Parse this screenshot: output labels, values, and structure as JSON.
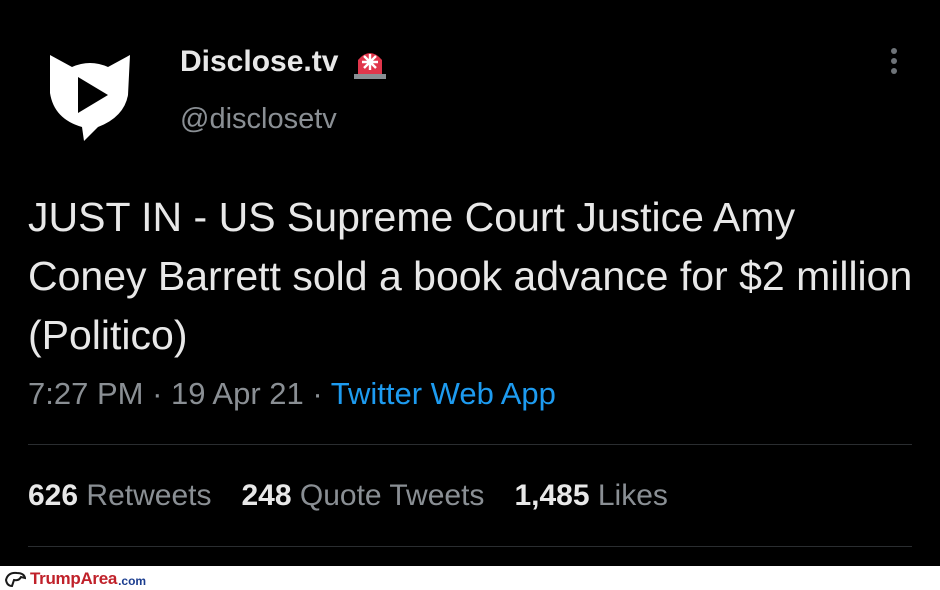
{
  "tweet": {
    "author_name": "Disclose.tv",
    "author_emoji": "siren-icon",
    "handle": "@disclosetv",
    "text": "JUST IN - US Supreme Court Justice Amy Coney Barrett sold a book advance for $2 million (Politico)",
    "time": "7:27 PM",
    "date": "19 Apr 21",
    "sep": "·",
    "source": "Twitter Web App",
    "stats": {
      "retweets_count": "626",
      "retweets_label": "Retweets",
      "quotes_count": "248",
      "quotes_label": "Quote Tweets",
      "likes_count": "1,485",
      "likes_label": "Likes"
    }
  },
  "colors": {
    "background": "#000000",
    "text": "#e8e8e8",
    "muted": "#8a8f94",
    "link": "#1d9bf0"
  },
  "watermark": {
    "brand": "TrumpArea",
    "suffix": ".com"
  }
}
